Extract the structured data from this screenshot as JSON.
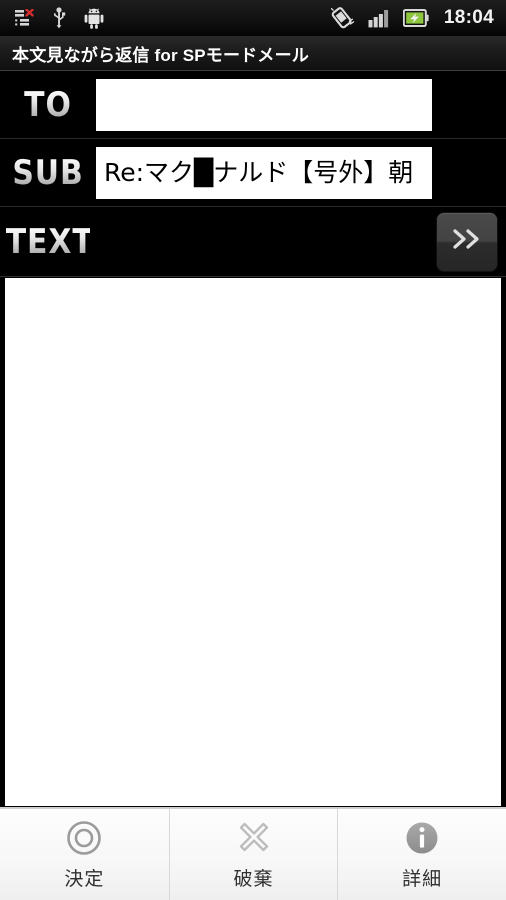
{
  "statusbar": {
    "time": "18:04",
    "left_icons": [
      {
        "name": "sync-error-icon",
        "glyph": "list-with-red-x"
      },
      {
        "name": "usb-icon",
        "glyph": "usb"
      },
      {
        "name": "android-robot-icon",
        "glyph": "android"
      }
    ],
    "right_icons": [
      {
        "name": "vibrate-mode-icon",
        "glyph": "phone-vibrate"
      },
      {
        "name": "signal-strength-icon",
        "glyph": "signal-bars",
        "bars": 4
      },
      {
        "name": "battery-charging-icon",
        "glyph": "battery-charging"
      }
    ],
    "colors": {
      "battery_fill": "#8ec63f",
      "error_mark": "#d42e2e",
      "icon": "#d8d8d8"
    }
  },
  "titlebar": {
    "title": "本文見ながら返信 for SPモードメール"
  },
  "fields": [
    {
      "label": "TO",
      "name": "to-field",
      "value": "",
      "placeholder": ""
    },
    {
      "label": "SUB",
      "name": "subject-field",
      "value": "Re:マク█ナルド【号外】朝",
      "placeholder": ""
    }
  ],
  "text_row": {
    "label": "TEXT",
    "next_button_label": "»",
    "next_button_name": "next-button"
  },
  "compose": {
    "body": "",
    "placeholder": ""
  },
  "bottombar": {
    "items": [
      {
        "label": "決定",
        "icon": "double-circle-icon",
        "name": "confirm-button"
      },
      {
        "label": "破棄",
        "icon": "close-x-icon",
        "name": "discard-button"
      },
      {
        "label": "詳細",
        "icon": "info-icon",
        "name": "details-button"
      }
    ],
    "colors": {
      "icon": "#9b9b9b",
      "label": "#303030",
      "background": "#f7f7f7"
    }
  }
}
